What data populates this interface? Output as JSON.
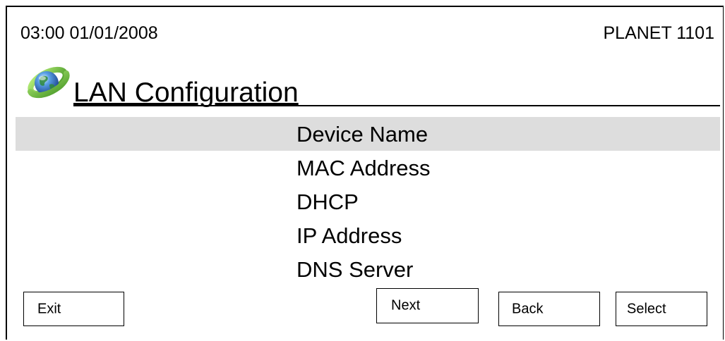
{
  "status_bar": {
    "datetime": "03:00 01/01/2008",
    "device_name": "PLANET 1101"
  },
  "header": {
    "title": "LAN Configuration",
    "icon": "globe-icon"
  },
  "menu": {
    "selected_index": 0,
    "items": [
      {
        "label": "Device Name"
      },
      {
        "label": "MAC Address"
      },
      {
        "label": "DHCP"
      },
      {
        "label": "IP Address"
      },
      {
        "label": "DNS Server"
      }
    ]
  },
  "buttons": {
    "exit": "Exit",
    "next": "Next",
    "back": "Back",
    "select": "Select"
  },
  "colors": {
    "selected_row_background": "#dddddd",
    "border": "#000000",
    "background": "#ffffff"
  }
}
